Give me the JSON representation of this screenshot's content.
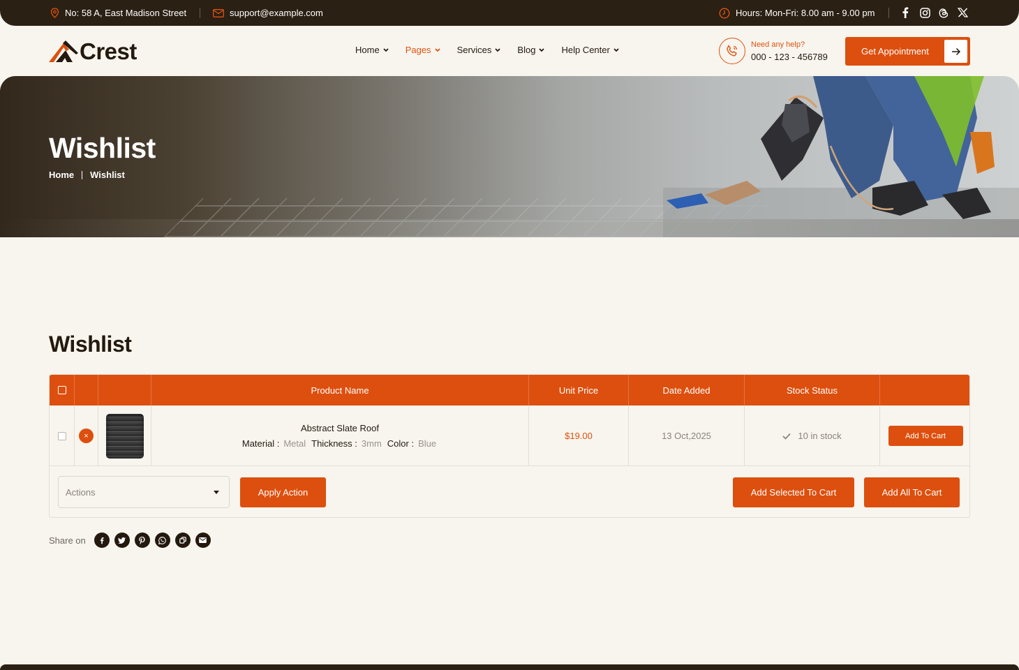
{
  "topbar": {
    "address": "No: 58 A, East Madison Street",
    "email": "support@example.com",
    "hours": "Hours: Mon-Fri: 8.00 am - 9.00 pm",
    "social": [
      "facebook-icon",
      "instagram-icon",
      "threads-icon",
      "x-icon"
    ]
  },
  "header": {
    "logo_text": "Crest",
    "nav": [
      {
        "label": "Home"
      },
      {
        "label": "Pages",
        "active": true
      },
      {
        "label": "Services"
      },
      {
        "label": "Blog"
      },
      {
        "label": "Help Center"
      }
    ],
    "help_label": "Need any help?",
    "help_phone": "000 - 123 - 456789",
    "cta_label": "Get Appointment"
  },
  "hero": {
    "title": "Wishlist",
    "breadcrumb": [
      "Home",
      "Wishlist"
    ]
  },
  "wishlist": {
    "title": "Wishlist",
    "columns": [
      "Product Name",
      "Unit Price",
      "Date Added",
      "Stock Status"
    ],
    "rows": [
      {
        "name": "Abstract Slate Roof",
        "attributes": [
          {
            "key": "Material :",
            "value": "Metal"
          },
          {
            "key": "Thickness :",
            "value": "3mm"
          },
          {
            "key": "Color :",
            "value": "Blue"
          }
        ],
        "price": "$19.00",
        "date": "13 Oct,2025",
        "stock": "10 in stock",
        "add_label": "Add To Cart",
        "remove_glyph": "×"
      }
    ],
    "actions_placeholder": "Actions",
    "apply_label": "Apply Action",
    "add_selected_label": "Add Selected To Cart",
    "add_all_label": "Add All To Cart"
  },
  "share": {
    "label": "Share on",
    "icons": [
      "facebook-icon",
      "twitter-icon",
      "pinterest-icon",
      "whatsapp-icon",
      "copy-link-icon",
      "email-icon"
    ]
  },
  "colors": {
    "accent": "#dd4f0e",
    "dark": "#2b2014",
    "background": "#f7f5ee"
  }
}
